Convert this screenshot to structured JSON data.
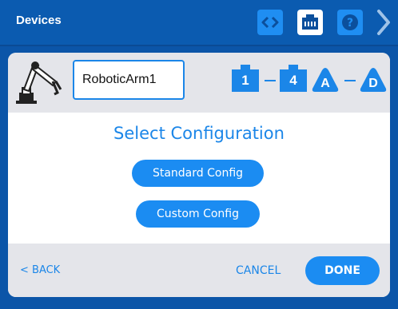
{
  "header": {
    "title": "Devices",
    "buttons": [
      {
        "icon": "code-icon",
        "accent": "#1f8ef2"
      },
      {
        "icon": "port-icon",
        "accent": "#ffffff"
      },
      {
        "icon": "help-icon",
        "accent": "#1f8ef2"
      },
      {
        "icon": "chevron-right-icon"
      }
    ]
  },
  "device": {
    "icon": "robotic-arm-icon",
    "name_value": "RoboticArm1",
    "ports": {
      "smart_start": "1",
      "smart_end": "4",
      "three_wire_start": "A",
      "three_wire_end": "D"
    }
  },
  "config": {
    "heading": "Select Configuration",
    "standard_label": "Standard Config",
    "custom_label": "Custom Config"
  },
  "footer": {
    "back_label": "< BACK",
    "cancel_label": "CANCEL",
    "done_label": "DONE"
  },
  "colors": {
    "background": "#0b55a8",
    "accent": "#1b86e8",
    "panel_gray": "#e4e5ea"
  }
}
